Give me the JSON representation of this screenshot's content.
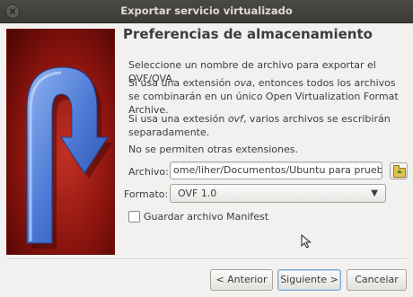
{
  "window": {
    "title": "Exportar servicio virtualizado"
  },
  "page": {
    "title": "Preferencias de almacenamiento",
    "p1": "Seleccione un nombre de archivo para exportar el OVF/OVA.",
    "p2_a": "Si usa una extensión ",
    "p2_ext": "ova",
    "p2_b": ", entonces todos los archivos se combinarán en un único Open Virtualization Format Archive.",
    "p3_a": "Si usa una extesión ",
    "p3_ext": "ovf",
    "p3_b": ", varios archivos se escribirán separadamente.",
    "p4": "No se permiten otras extensiones."
  },
  "file": {
    "label": "Archivo:",
    "value": "ome/liher/Documentos/Ubuntu para pruebas.ova"
  },
  "format": {
    "label": "Formato:",
    "value": "OVF 1.0"
  },
  "manifest": {
    "label": "Guardar archivo Manifest",
    "checked": false
  },
  "buttons": {
    "back": "< Anterior",
    "next": "Siguiente >",
    "cancel": "Cancelar"
  },
  "icons": {
    "close": "close-icon",
    "folder": "folder-open-icon",
    "chevron": "chevron-down-icon",
    "banner": "export-arrow-graphic"
  },
  "colors": {
    "titlebar": "#3c3b37",
    "banner_red": "#a3180f",
    "arrow_blue": "#4f7fd6"
  }
}
